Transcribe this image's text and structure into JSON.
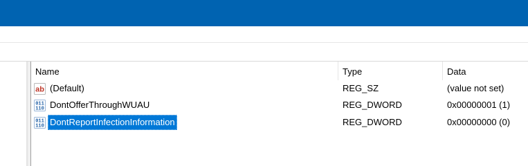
{
  "list": {
    "columns": {
      "name": "Name",
      "type": "Type",
      "data": "Data"
    },
    "rows": [
      {
        "name": "(Default)",
        "type": "REG_SZ",
        "data": "(value not set)",
        "icon": "string-value-icon",
        "selected": false
      },
      {
        "name": "DontOfferThroughWUAU",
        "type": "REG_DWORD",
        "data": "0x00000001 (1)",
        "icon": "dword-value-icon",
        "selected": false
      },
      {
        "name": "DontReportInfectionInformation",
        "type": "REG_DWORD",
        "data": "0x00000000 (0)",
        "icon": "dword-value-icon",
        "selected": true
      }
    ]
  },
  "icons": {
    "string_value_glyph": "ab",
    "dword_value_glyph_top": "011",
    "dword_value_glyph_bottom": "110"
  },
  "colors": {
    "titlebar": "#0063b1",
    "selection": "#0078d7",
    "string_icon": "#c0392b",
    "dword_icon": "#1f5fa6"
  }
}
